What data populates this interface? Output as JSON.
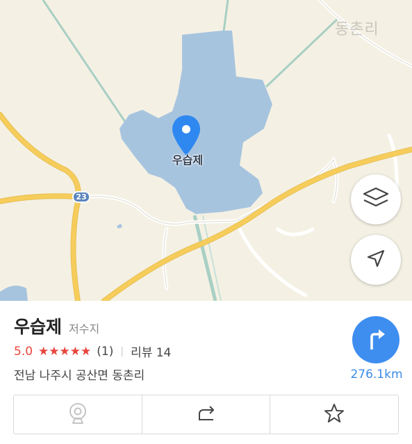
{
  "map": {
    "village_label": "동촌리",
    "poi_label": "우습제",
    "route_shield": "23",
    "water_color": "#a7c4df",
    "road_color": "#f6cd5b"
  },
  "controls": {
    "layers_icon": "layers-icon",
    "locate_icon": "navigation-arrow-icon"
  },
  "place": {
    "name": "우습제",
    "category": "저수지",
    "rating": "5.0",
    "stars": "★★★★★",
    "rating_count": "(1)",
    "separator": "|",
    "review_label": "리뷰 14",
    "address": "전남 나주시 공산면 동촌리",
    "distance": "276.1km",
    "accent_color": "#3e8ef0",
    "rating_color": "#e8453c"
  },
  "actions": [
    {
      "icon": "streetview-camera-icon"
    },
    {
      "icon": "share-icon"
    },
    {
      "icon": "star-outline-icon"
    }
  ]
}
